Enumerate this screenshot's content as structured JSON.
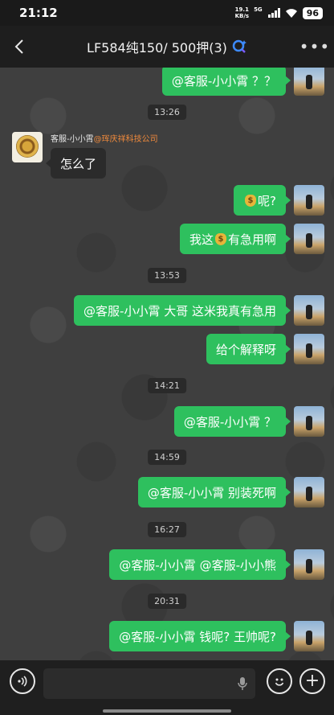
{
  "status_bar": {
    "time": "21:12",
    "net_speed_value": "19.1",
    "net_speed_unit": "KB/s",
    "network": "5G",
    "battery": "96"
  },
  "header": {
    "title": "LF584纯150/ 500押(3)",
    "back_icon": "chevron-left-icon",
    "more_icon": "ellipsis-icon"
  },
  "chat": {
    "messages": [
      {
        "type": "out",
        "text": "@客服-小小霄 ？？"
      },
      {
        "type": "time",
        "text": "13:26"
      },
      {
        "type": "in",
        "sender": "客服-小小霄",
        "company": "@珲庆祥科技公司",
        "text": "怎么了"
      },
      {
        "type": "out",
        "text_after": "呢?"
      },
      {
        "type": "out",
        "text_before": "我这",
        "text_after": "有急用啊"
      },
      {
        "type": "time",
        "text": "13:53"
      },
      {
        "type": "out",
        "text": "@客服-小小霄  大哥 这米我真有急用"
      },
      {
        "type": "out",
        "text": "给个解释呀"
      },
      {
        "type": "time",
        "text": "14:21"
      },
      {
        "type": "out",
        "text": "@客服-小小霄 ？"
      },
      {
        "type": "time",
        "text": "14:59"
      },
      {
        "type": "out",
        "text": "@客服-小小霄  别装死啊"
      },
      {
        "type": "time",
        "text": "16:27"
      },
      {
        "type": "out",
        "text": "@客服-小小霄 @客服-小小熊"
      },
      {
        "type": "time",
        "text": "20:31"
      },
      {
        "type": "out",
        "text": "@客服-小小霄  钱呢? 王帅呢?"
      }
    ]
  },
  "input_bar": {
    "placeholder": "",
    "voice_icon": "voice-icon",
    "mic_icon": "mic-icon",
    "emoji_icon": "emoji-icon",
    "plus_icon": "plus-icon"
  },
  "colors": {
    "outgoing_bubble": "#2ec05e",
    "incoming_bubble": "#2b2b2b",
    "company_tag": "#f08a3c"
  }
}
